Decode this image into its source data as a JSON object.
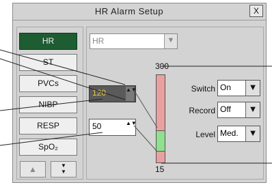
{
  "window": {
    "title": "HR  Alarm Setup",
    "close_label": "X"
  },
  "tabs": [
    {
      "label": "HR",
      "active": true
    },
    {
      "label": "ST",
      "active": false
    },
    {
      "label": "PVCs",
      "active": false
    },
    {
      "label": "NIBP",
      "active": false
    },
    {
      "label": "RESP",
      "active": false
    },
    {
      "label": "SpO₂",
      "active": false
    }
  ],
  "scroll": {
    "up_icon": "▲",
    "down_icon": "▼▼"
  },
  "parameter_select": {
    "value": "HR",
    "arrow": "▼"
  },
  "limits": {
    "upper": {
      "value": "120",
      "arrows": "▲▼"
    },
    "lower": {
      "value": "50",
      "arrows": "▲▼"
    }
  },
  "scale": {
    "max_label": "300",
    "min_label": "15",
    "max": 300,
    "min": 15,
    "upper_limit": 120,
    "lower_limit": 50
  },
  "options": [
    {
      "label": "Switch",
      "value": "On"
    },
    {
      "label": "Record",
      "value": "Off"
    },
    {
      "label": "Level",
      "value": "Med."
    }
  ],
  "dropdown_arrow": "▼",
  "colors": {
    "active_tab": "#1e5c32",
    "bar_alarm": "#e8a0a0",
    "bar_normal": "#8fe08f",
    "active_value": "#e6c94a"
  }
}
